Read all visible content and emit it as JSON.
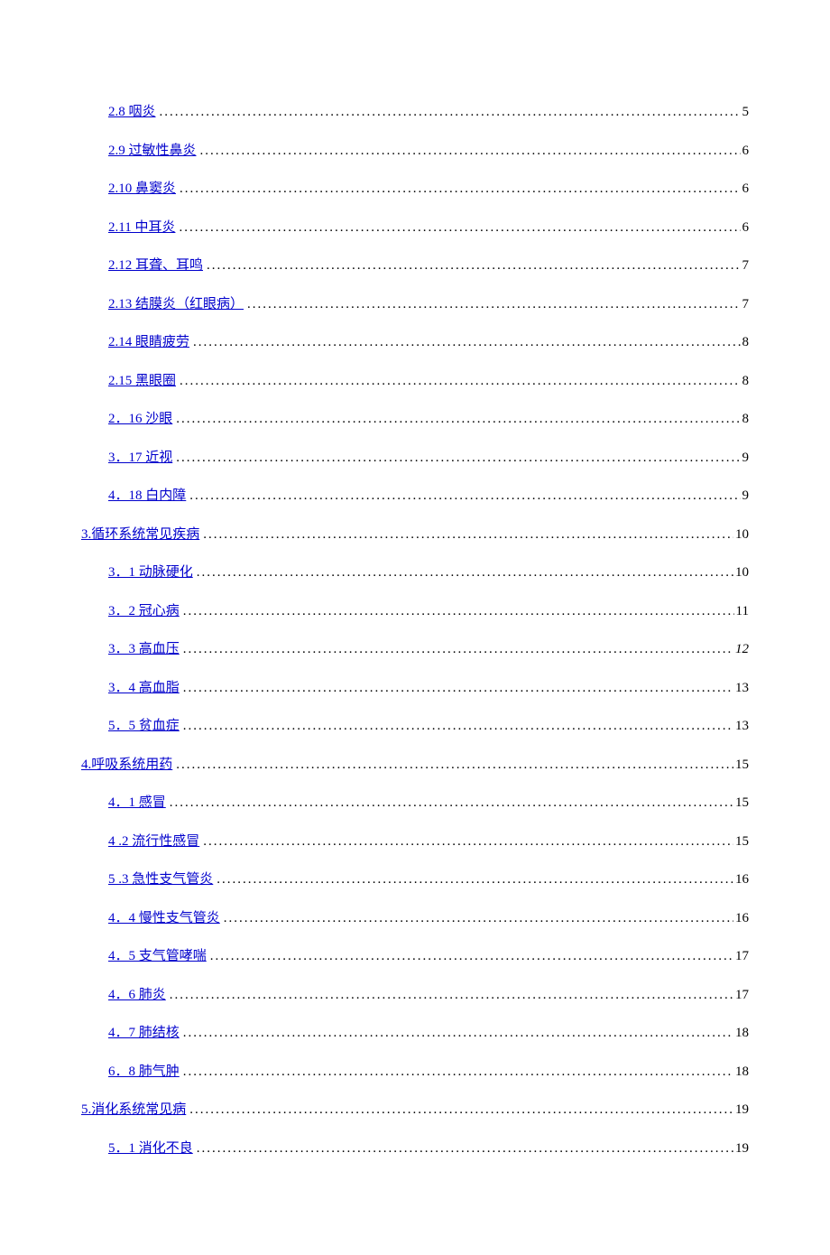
{
  "toc": [
    {
      "level": 1,
      "label": "2.8 咽炎",
      "page": "5",
      "italic": false
    },
    {
      "level": 1,
      "label": "2.9 过敏性鼻炎",
      "page": "6",
      "italic": false
    },
    {
      "level": 1,
      "label": "2.10 鼻窦炎",
      "page": "6",
      "italic": false
    },
    {
      "level": 1,
      "label": "2.11 中耳炎",
      "page": "6",
      "italic": false
    },
    {
      "level": 1,
      "label": "2.12 耳聋、耳鸣",
      "page": "7",
      "italic": false
    },
    {
      "level": 1,
      "label": "2.13 结膜炎（红眼病）",
      "page": "7",
      "italic": false
    },
    {
      "level": 1,
      "label": "2.14 眼睛疲劳",
      "page": "8",
      "italic": false
    },
    {
      "level": 1,
      "label": "2.15 黑眼圈",
      "page": "8",
      "italic": false
    },
    {
      "level": 1,
      "label": "2．16 沙眼",
      "page": "8",
      "italic": false
    },
    {
      "level": 1,
      "label": "3．17 近视",
      "page": "9",
      "italic": false
    },
    {
      "level": 1,
      "label": "4．18 白内障",
      "page": "9",
      "italic": false
    },
    {
      "level": 0,
      "label": "3.循环系统常见疾病",
      "page": "10",
      "italic": false
    },
    {
      "level": 1,
      "label": "3．1 动脉硬化",
      "page": "10",
      "italic": false
    },
    {
      "level": 1,
      "label": "3．2 冠心病",
      "page": "11",
      "italic": false
    },
    {
      "level": 1,
      "label": "3．3 高血压",
      "page": "12",
      "italic": true
    },
    {
      "level": 1,
      "label": "3．4 高血脂",
      "page": "13",
      "italic": false
    },
    {
      "level": 1,
      "label": "5．5 贫血症",
      "page": "13",
      "italic": false
    },
    {
      "level": 0,
      "label": "4.呼吸系统用药",
      "page": "15",
      "italic": false
    },
    {
      "level": 1,
      "label": "4．1 感冒",
      "page": "15",
      "italic": false
    },
    {
      "level": 1,
      "label": "4 .2 流行性感冒",
      "page": "15",
      "italic": false
    },
    {
      "level": 1,
      "label": "5 .3 急性支气管炎",
      "page": "16",
      "italic": false
    },
    {
      "level": 1,
      "label": "4．4 慢性支气管炎",
      "page": "16",
      "italic": false
    },
    {
      "level": 1,
      "label": "4．5 支气管哮喘",
      "page": "17",
      "italic": false
    },
    {
      "level": 1,
      "label": "4．6 肺炎",
      "page": "17",
      "italic": false
    },
    {
      "level": 1,
      "label": "4．7 肺结核",
      "page": "18",
      "italic": false
    },
    {
      "level": 1,
      "label": "6．8 肺气肿",
      "page": "18",
      "italic": false
    },
    {
      "level": 0,
      "label": "5.消化系统常见病",
      "page": "19",
      "italic": false
    },
    {
      "level": 1,
      "label": "5．1 消化不良",
      "page": "19",
      "italic": false
    }
  ]
}
